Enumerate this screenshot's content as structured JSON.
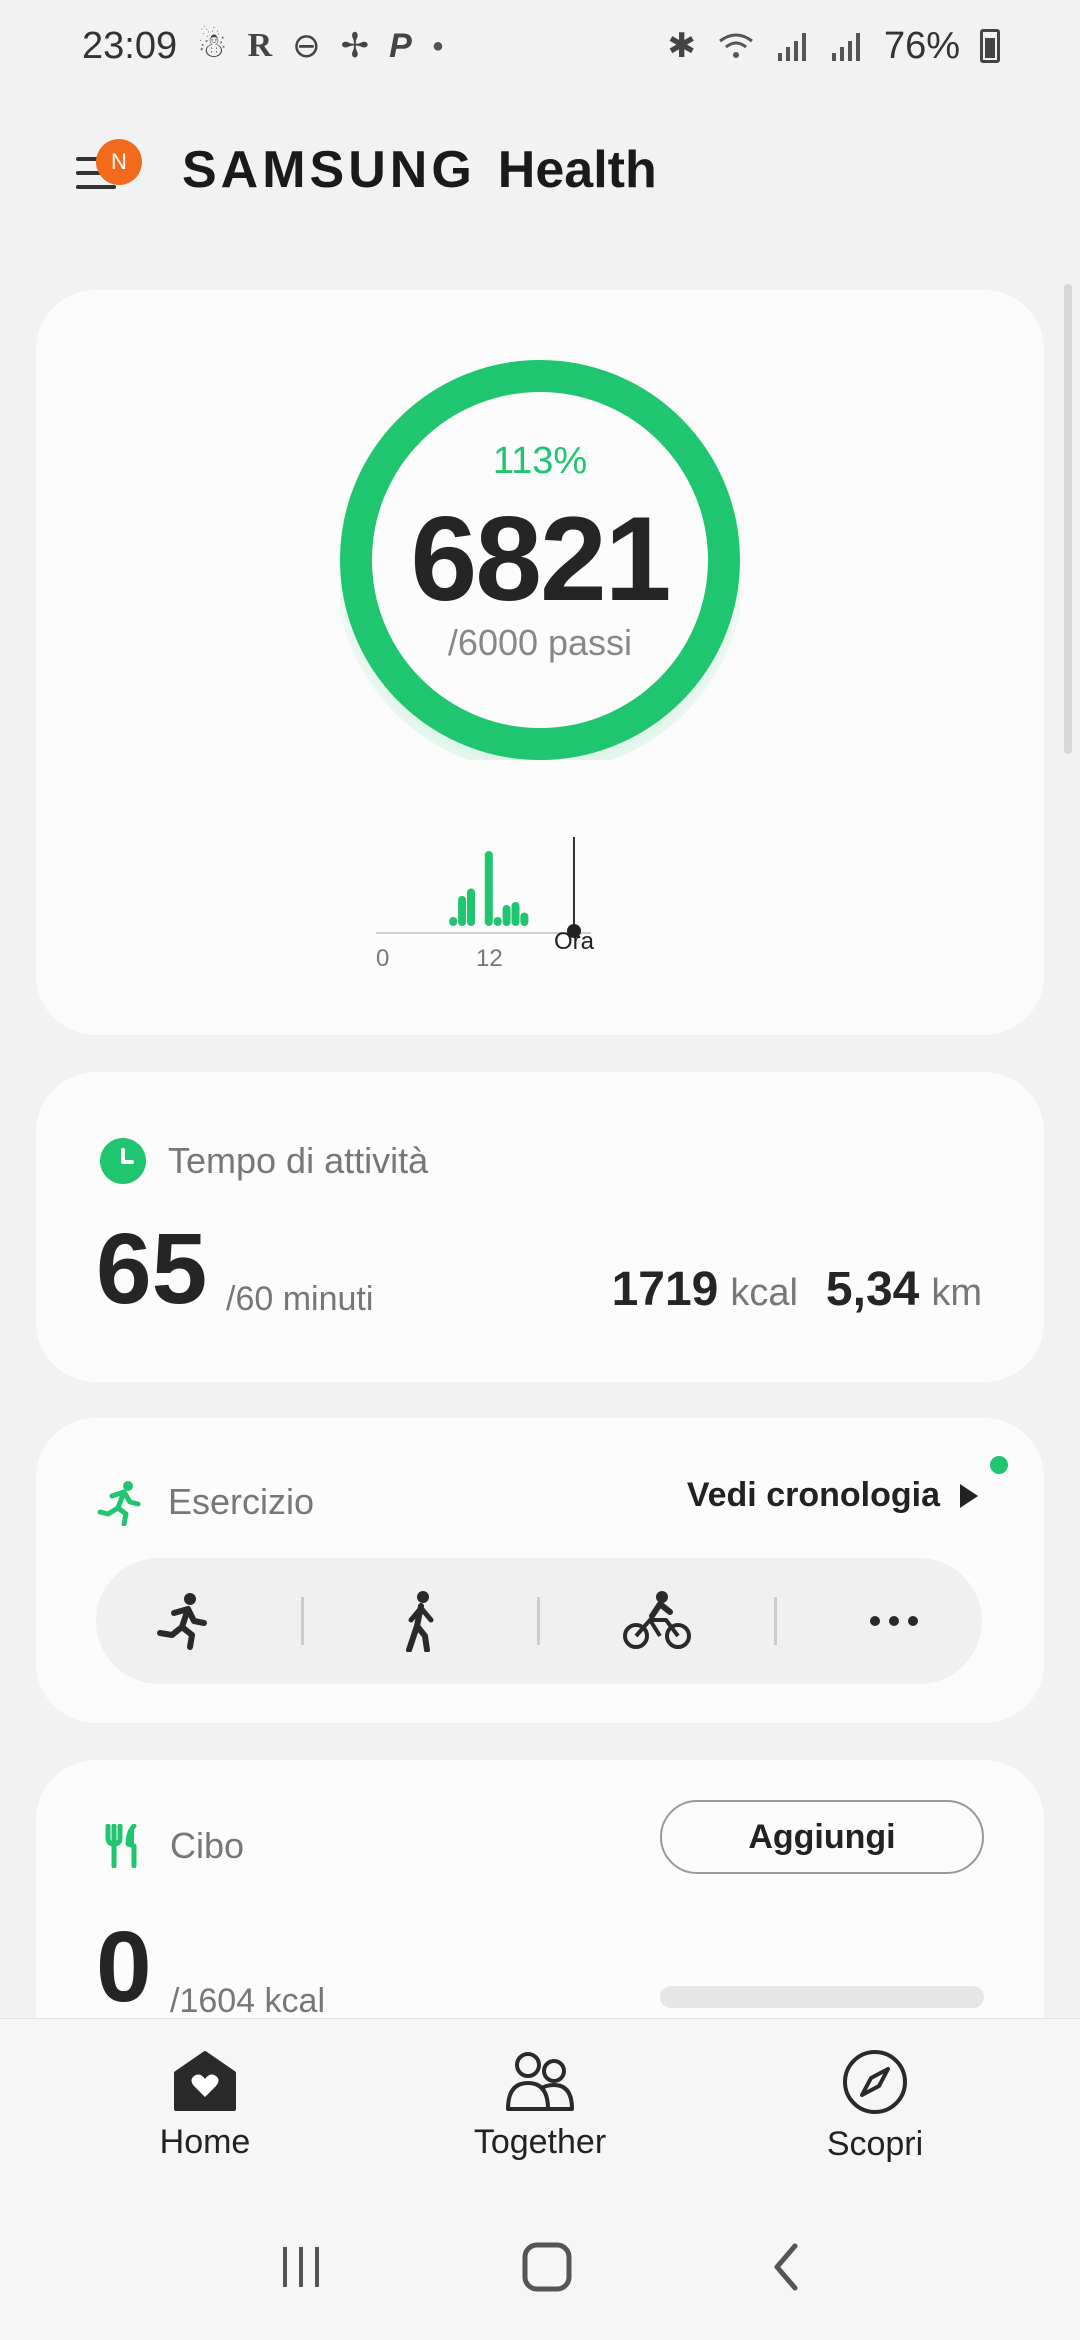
{
  "status_bar": {
    "time": "23:09",
    "battery": "76%",
    "left_icons": [
      "activity-icon",
      "r-icon",
      "dnd-icon",
      "pinwheel-icon",
      "paypal-icon",
      "dot-icon"
    ],
    "right_icons": [
      "bluetooth-icon",
      "wifi-icon",
      "signal-icon",
      "signal-icon",
      "battery-icon"
    ]
  },
  "header": {
    "badge": "N",
    "brand_samsung": "SAMSUNG",
    "brand_health": "Health"
  },
  "steps": {
    "percent": "113%",
    "count": "6821",
    "goal": "/6000 passi",
    "progress_fraction": 1.0,
    "ring_color": "#1fc66f"
  },
  "step_chart": {
    "ticks": [
      "0",
      "12",
      "Ora"
    ]
  },
  "chart_data": {
    "type": "bar",
    "title": "",
    "x_ticks": [
      "0",
      "12",
      "Ora"
    ],
    "x": [
      8,
      9,
      10,
      11,
      12,
      13,
      14,
      15,
      16,
      17
    ],
    "values": [
      0.12,
      0.4,
      0.5,
      0,
      1.0,
      0.12,
      0.28,
      0.32,
      0.18,
      0
    ],
    "ylim": [
      0,
      1
    ],
    "current_marker_label": "Ora",
    "color": "#1fc66f"
  },
  "activity": {
    "title": "Tempo di attività",
    "value": "65",
    "goal": "/60 minuti",
    "kcal_value": "1719",
    "kcal_unit": "kcal",
    "km_value": "5,34",
    "km_unit": "km"
  },
  "exercise": {
    "title": "Esercizio",
    "history_link": "Vedi cronologia",
    "icons": [
      "running-icon",
      "walking-icon",
      "cycling-icon",
      "more-icon"
    ]
  },
  "food": {
    "title": "Cibo",
    "add_label": "Aggiungi",
    "value": "0",
    "goal": "/1604 kcal",
    "progress_fraction": 0
  },
  "bottom_nav": {
    "home": "Home",
    "together": "Together",
    "discover": "Scopri"
  },
  "colors": {
    "accent": "#1fc66f",
    "badge": "#f26b1d"
  }
}
